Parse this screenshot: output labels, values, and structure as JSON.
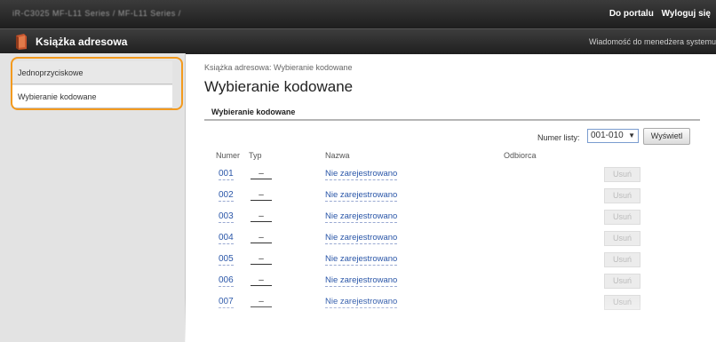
{
  "top_bar": {
    "device_name": "iR-C3025  MF-L11 Series / MF-L11 Series /",
    "portal_link": "Do portalu",
    "logout_link": "Wyloguj się"
  },
  "title_bar": {
    "app_title": "Książka adresowa",
    "admin_message": "Wiadomość do menedżera systemu"
  },
  "sidebar": {
    "items": [
      {
        "label": "Jednoprzyciskowe"
      },
      {
        "label": "Wybieranie kodowane"
      }
    ]
  },
  "main": {
    "breadcrumb": "Książka adresowa: Wybieranie kodowane",
    "title": "Wybieranie kodowane",
    "section_title": "Wybieranie kodowane",
    "list_number_label": "Numer listy:",
    "list_number_value": "001-010",
    "show_button": "Wyświetl",
    "columns": {
      "number": "Numer",
      "type": "Typ",
      "name": "Nazwa",
      "recipient": "Odbiorca"
    },
    "rows": [
      {
        "number": "001",
        "type": "–",
        "name": "Nie zarejestrowano",
        "action": "Usuń"
      },
      {
        "number": "002",
        "type": "–",
        "name": "Nie zarejestrowano",
        "action": "Usuń"
      },
      {
        "number": "003",
        "type": "–",
        "name": "Nie zarejestrowano",
        "action": "Usuń"
      },
      {
        "number": "004",
        "type": "–",
        "name": "Nie zarejestrowano",
        "action": "Usuń"
      },
      {
        "number": "005",
        "type": "–",
        "name": "Nie zarejestrowano",
        "action": "Usuń"
      },
      {
        "number": "006",
        "type": "–",
        "name": "Nie zarejestrowano",
        "action": "Usuń"
      },
      {
        "number": "007",
        "type": "–",
        "name": "Nie zarejestrowano",
        "action": "Usuń"
      }
    ]
  },
  "colors": {
    "highlight": "#f39a1e",
    "link": "#2a56a8",
    "header_bg": "#2b2b2b"
  }
}
